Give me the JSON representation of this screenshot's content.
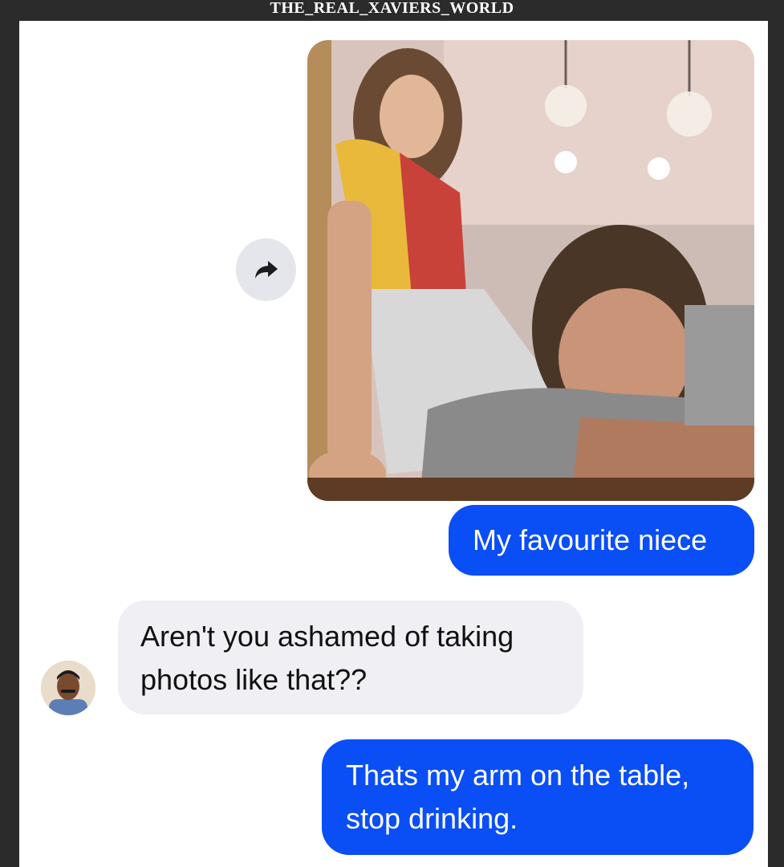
{
  "watermark": "THE_REAL_XAVIERS_WORLD",
  "conversation": {
    "shared_photo_icon": "forward-arrow-icon",
    "messages": [
      {
        "sender": "me",
        "text": "My favourite niece"
      },
      {
        "sender": "contact",
        "line1": "Aren't you ashamed of taking",
        "line2": "photos like that??"
      },
      {
        "sender": "me",
        "line1": "Thats my arm on the table,",
        "line2": "stop drinking."
      }
    ]
  },
  "colors": {
    "outgoing_bubble": "#0a4ef5",
    "incoming_bubble": "#efeff4",
    "share_button": "#e4e6eb"
  }
}
